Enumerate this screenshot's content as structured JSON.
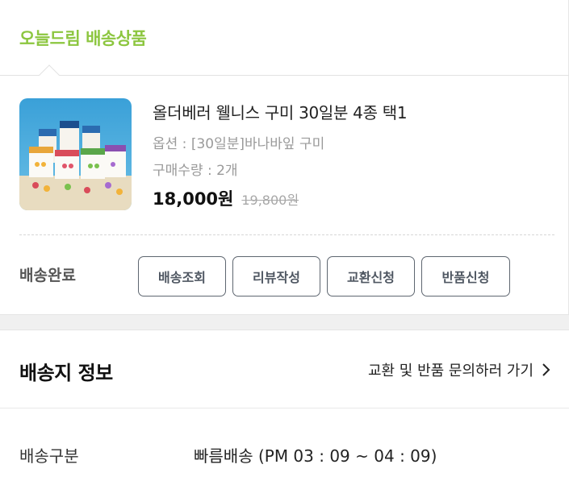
{
  "section": {
    "title": "오늘드림 배송상품"
  },
  "product": {
    "image_icon": "product-photo",
    "name": "올더베러 웰니스 구미 30일분 4종 택1",
    "option": "옵션 : [30일분]바나바잎 구미",
    "quantity": "구매수량 : 2개",
    "price": "18,000원",
    "original_price": "19,800원"
  },
  "delivery": {
    "status": "배송완료",
    "buttons": [
      {
        "label": "배송조회"
      },
      {
        "label": "리뷰작성"
      },
      {
        "label": "교환신청"
      },
      {
        "label": "반품신청"
      }
    ]
  },
  "shipping_info": {
    "title": "배송지 정보",
    "link_label": "교환 및 반품 문의하러 가기",
    "link_icon": "chevron-right-icon",
    "rows": [
      {
        "label": "배송구분",
        "value": "빠름배송 (PM 03 : 09 ~ 04 : 09)"
      }
    ]
  },
  "colors": {
    "accent": "#8cc63f",
    "button_border": "#5e6670",
    "muted_text": "#9a9a9a"
  }
}
